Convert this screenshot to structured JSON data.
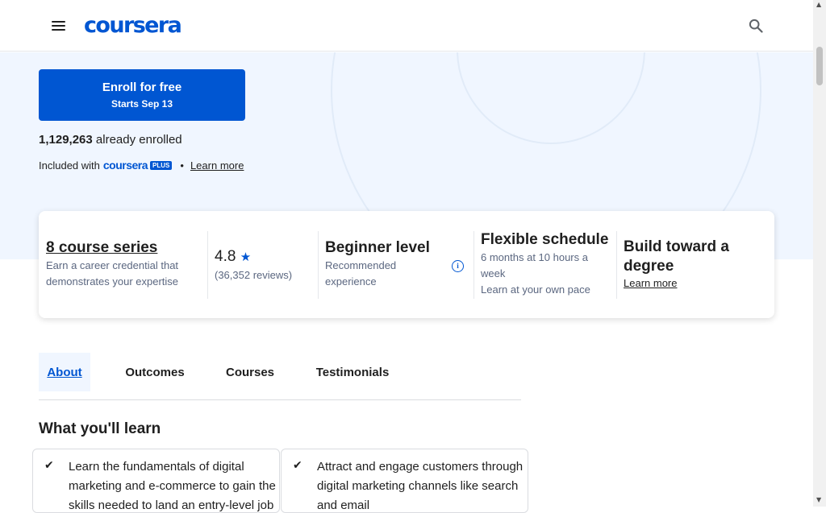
{
  "header": {
    "logo_text": "coursera",
    "menu_icon": "hamburger-menu-icon",
    "search_icon": "search-icon"
  },
  "enroll": {
    "button_label": "Enroll for free",
    "start_date": "Starts Sep 13",
    "enrolled_count": "1,129,263",
    "enrolled_suffix": "already enrolled",
    "included_prefix": "Included with",
    "plus_brand": "coursera",
    "plus_badge": "PLUS",
    "separator": "•",
    "learn_more": "Learn more"
  },
  "info_card": {
    "series": {
      "title": "8 course series",
      "desc": "Earn a career credential that demonstrates your expertise"
    },
    "rating": {
      "value": "4.8",
      "star_icon": "star-icon",
      "reviews": "(36,352 reviews)"
    },
    "level": {
      "title": "Beginner level",
      "desc": "Recommended experience",
      "info_icon": "info-icon"
    },
    "schedule": {
      "title": "Flexible schedule",
      "desc1": "6 months at 10 hours a week",
      "desc2": "Learn at your own pace"
    },
    "degree": {
      "title": "Build toward a degree",
      "link": "Learn more"
    }
  },
  "tabs": [
    {
      "label": "About",
      "active": true
    },
    {
      "label": "Outcomes",
      "active": false
    },
    {
      "label": "Courses",
      "active": false
    },
    {
      "label": "Testimonials",
      "active": false
    }
  ],
  "learn": {
    "heading": "What you'll learn",
    "items": [
      "Learn the fundamentals of digital marketing and e-commerce to gain the skills needed to land an entry-level job",
      "Attract and engage customers through digital marketing channels like search and email"
    ]
  },
  "colors": {
    "brand": "#0056d2",
    "hero_bg": "#f0f6ff"
  }
}
